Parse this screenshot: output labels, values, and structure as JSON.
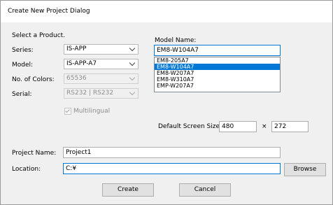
{
  "window": {
    "title": "Create New Project Dialog"
  },
  "product": {
    "section_label": "Select a Product.",
    "series_label": "Series:",
    "series_value": "IS-APP",
    "model_label": "Model:",
    "model_value": "IS-APP-A7",
    "colors_label": "No. of Colors:",
    "colors_value": "65536",
    "serial_label": "Serial:",
    "serial_value": "RS232 | RS232",
    "multilingual_label": "Multilingual"
  },
  "model_name": {
    "label": "Model Name:",
    "value": "EM8-W104A7",
    "items": [
      {
        "label": "EM8-205A7"
      },
      {
        "label": "EM8-W104A7"
      },
      {
        "label": "EM8-W207A7"
      },
      {
        "label": "EM8-W310A7"
      },
      {
        "label": "EMP-W207A7"
      }
    ]
  },
  "screen_size": {
    "label": "Default Screen Size:",
    "width": "480",
    "times": "×",
    "height": "272"
  },
  "project": {
    "name_label": "Project Name:",
    "name_value": "Project1",
    "location_label": "Location:",
    "location_value": "C:¥",
    "browse_label": "Browse"
  },
  "buttons": {
    "create": "Create",
    "cancel": "Cancel"
  }
}
